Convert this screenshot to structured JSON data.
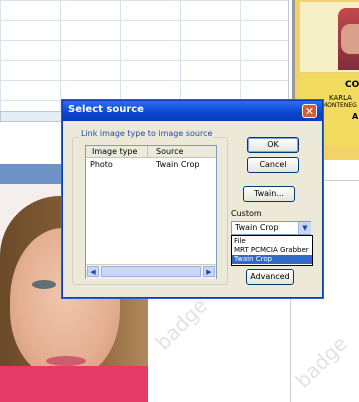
{
  "background": {
    "card_text": [
      "CO",
      "KARLA",
      "MONTENEG",
      "A"
    ],
    "watermark": "badge"
  },
  "dialog": {
    "title": "Select source",
    "close_glyph": "✕",
    "group_label": "Link image type to image source",
    "columns": [
      "Image type",
      "Source"
    ],
    "rows": [
      {
        "image_type": "Photo",
        "source": "Twain Crop"
      }
    ],
    "scroll_left_glyph": "◀",
    "scroll_right_glyph": "▶",
    "buttons": {
      "ok": "OK",
      "cancel": "Cancel",
      "twain": "Twain...",
      "advanced": "Advanced"
    },
    "custom_label": "Custom",
    "custom_select": {
      "value": "Twain Crop",
      "arrow_glyph": "▼",
      "options": [
        "File",
        "MRT PCMCIA Grabber",
        "Twain Crop"
      ],
      "selected_option": "Twain Crop"
    }
  },
  "colors": {
    "title_bar": "#0b45d0",
    "selection": "#316ac5",
    "close_button": "#d75a34"
  }
}
